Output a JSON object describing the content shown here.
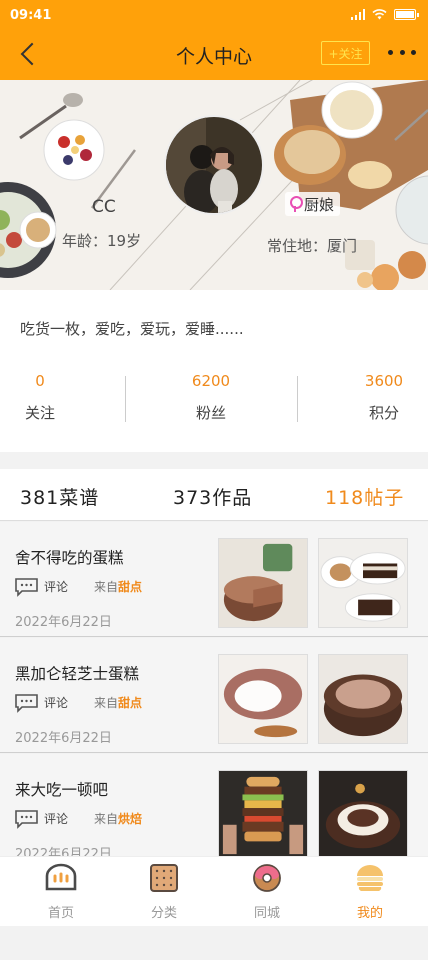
{
  "status": {
    "time": "09:41"
  },
  "nav": {
    "title": "个人中心",
    "follow_label": "+关注"
  },
  "user": {
    "name": "CC",
    "age_label": "年龄：",
    "age": "19岁",
    "tag": "厨娘",
    "location_label": "常住地：",
    "location": "厦门",
    "bio": "吃货一枚，爱吃，爱玩，爱睡......"
  },
  "stats": [
    {
      "value": "0",
      "label": "关注"
    },
    {
      "value": "6200",
      "label": "粉丝"
    },
    {
      "value": "3600",
      "label": "积分"
    }
  ],
  "content_tabs": [
    {
      "label": "381菜谱"
    },
    {
      "label": "373作品"
    },
    {
      "label": "118帖子"
    }
  ],
  "posts": [
    {
      "title": "舍不得吃的蛋糕",
      "comment_label": "评论",
      "from_label": "来自",
      "category": "甜点",
      "date": "2022年6月22日"
    },
    {
      "title": "黑加仑轻芝士蛋糕",
      "comment_label": "评论",
      "from_label": "来自",
      "category": "甜点",
      "date": "2022年6月22日"
    },
    {
      "title": "来大吃一顿吧",
      "comment_label": "评论",
      "from_label": "来自",
      "category": "烘焙",
      "date": "2022年6月22日"
    }
  ],
  "tabbar": [
    {
      "label": "首页",
      "icon": "bread-icon"
    },
    {
      "label": "分类",
      "icon": "biscuit-icon"
    },
    {
      "label": "同城",
      "icon": "donut-icon"
    },
    {
      "label": "我的",
      "icon": "burger-icon"
    }
  ],
  "colors": {
    "brand": "#ffa10a",
    "accent": "#f08a1c"
  }
}
